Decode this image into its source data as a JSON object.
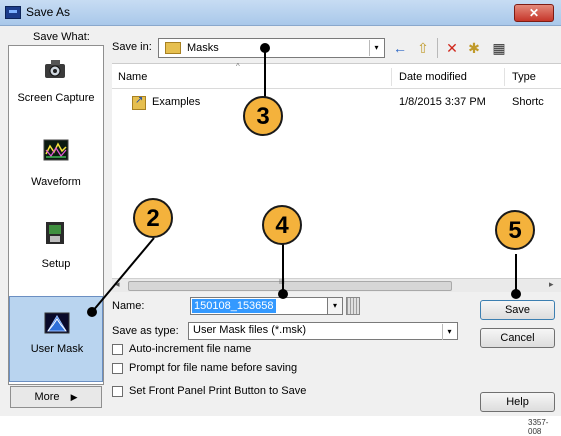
{
  "window": {
    "title": "Save As",
    "close_icon_label": "✕"
  },
  "left_panel": {
    "save_what_label": "Save What:",
    "items": [
      {
        "label": "Screen Capture",
        "icon": "camera-icon"
      },
      {
        "label": "Waveform",
        "icon": "waveform-icon"
      },
      {
        "label": "Setup",
        "icon": "setup-icon"
      },
      {
        "label": "User Mask",
        "icon": "user-mask-icon",
        "selected": true
      }
    ],
    "more_label": "More",
    "more_arrow": "▶"
  },
  "toolbar": {
    "save_in_label": "Save in:",
    "save_in_value": "Masks",
    "combo_arrow": "▾",
    "icons": [
      "back-icon",
      "up-folder-icon",
      "delete-icon",
      "new-folder-icon",
      "view-menu-icon"
    ],
    "back_glyph": "←",
    "up_glyph": "⇧",
    "delete_glyph": "✕",
    "new_folder_glyph": "✱",
    "view_glyph": "▦"
  },
  "file_list": {
    "columns": [
      "Name",
      "Date modified",
      "Type"
    ],
    "sort_indicator": "^",
    "rows": [
      {
        "name": "Examples",
        "date": "1/8/2015 3:37 PM",
        "type": "Shortc"
      }
    ]
  },
  "scrollbar": {
    "left_arrow": "◂",
    "right_arrow": "▸",
    "grip": "III"
  },
  "form": {
    "name_label": "Name:",
    "name_value": "150108_153658",
    "save_as_type_label": "Save as type:",
    "save_as_type_value": "User Mask files (*.msk)",
    "checkboxes": [
      {
        "label": "Auto-increment file name",
        "checked": false
      },
      {
        "label": "Prompt for file name before saving",
        "checked": false
      },
      {
        "label": "Set Front Panel Print Button to Save",
        "checked": false
      }
    ]
  },
  "buttons": {
    "save": "Save",
    "cancel": "Cancel",
    "help": "Help"
  },
  "callouts": [
    "2",
    "3",
    "4",
    "5"
  ],
  "figure_number": "3357-008",
  "colors": {
    "callout_fill": "#f4b23c",
    "selected_item": "#b9d4ef",
    "name_highlight": "#3399ff"
  }
}
